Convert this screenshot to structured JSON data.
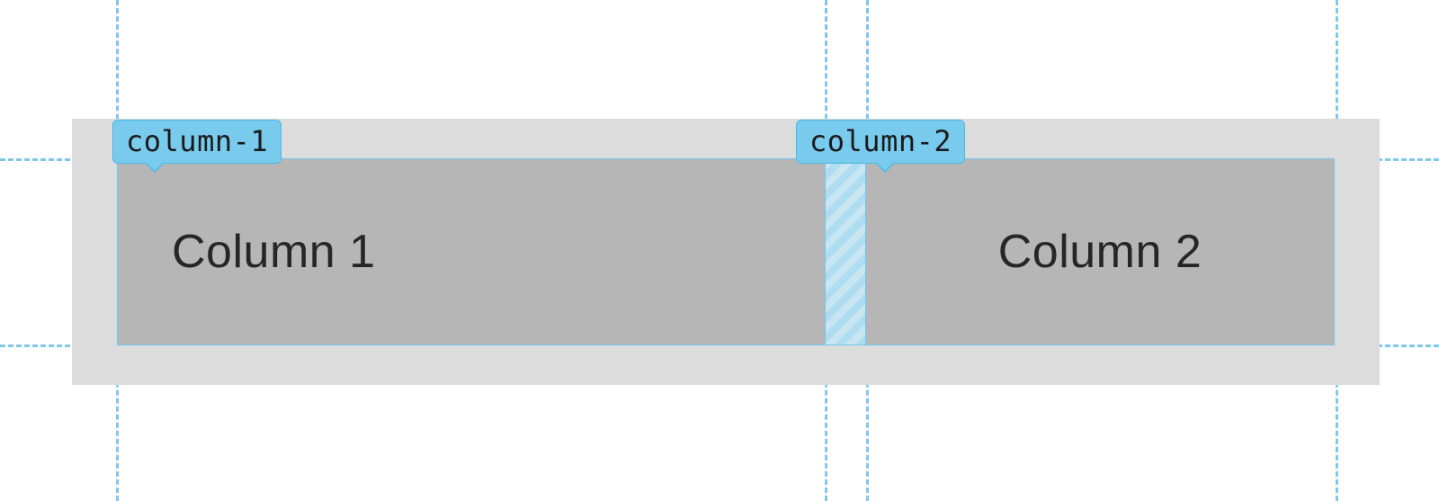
{
  "labels": {
    "column1_badge": "column-1",
    "column2_badge": "column-2",
    "column1_text": "Column 1",
    "column2_text": "Column 2"
  },
  "colors": {
    "container_bg": "#dcdcdc",
    "cell_bg": "#b6b6b6",
    "overlay_accent": "#79cbee",
    "guide_line": "#7fc8ea"
  },
  "layout": {
    "columns": [
      "column-1",
      "column-2"
    ],
    "gap_between_columns": true
  }
}
